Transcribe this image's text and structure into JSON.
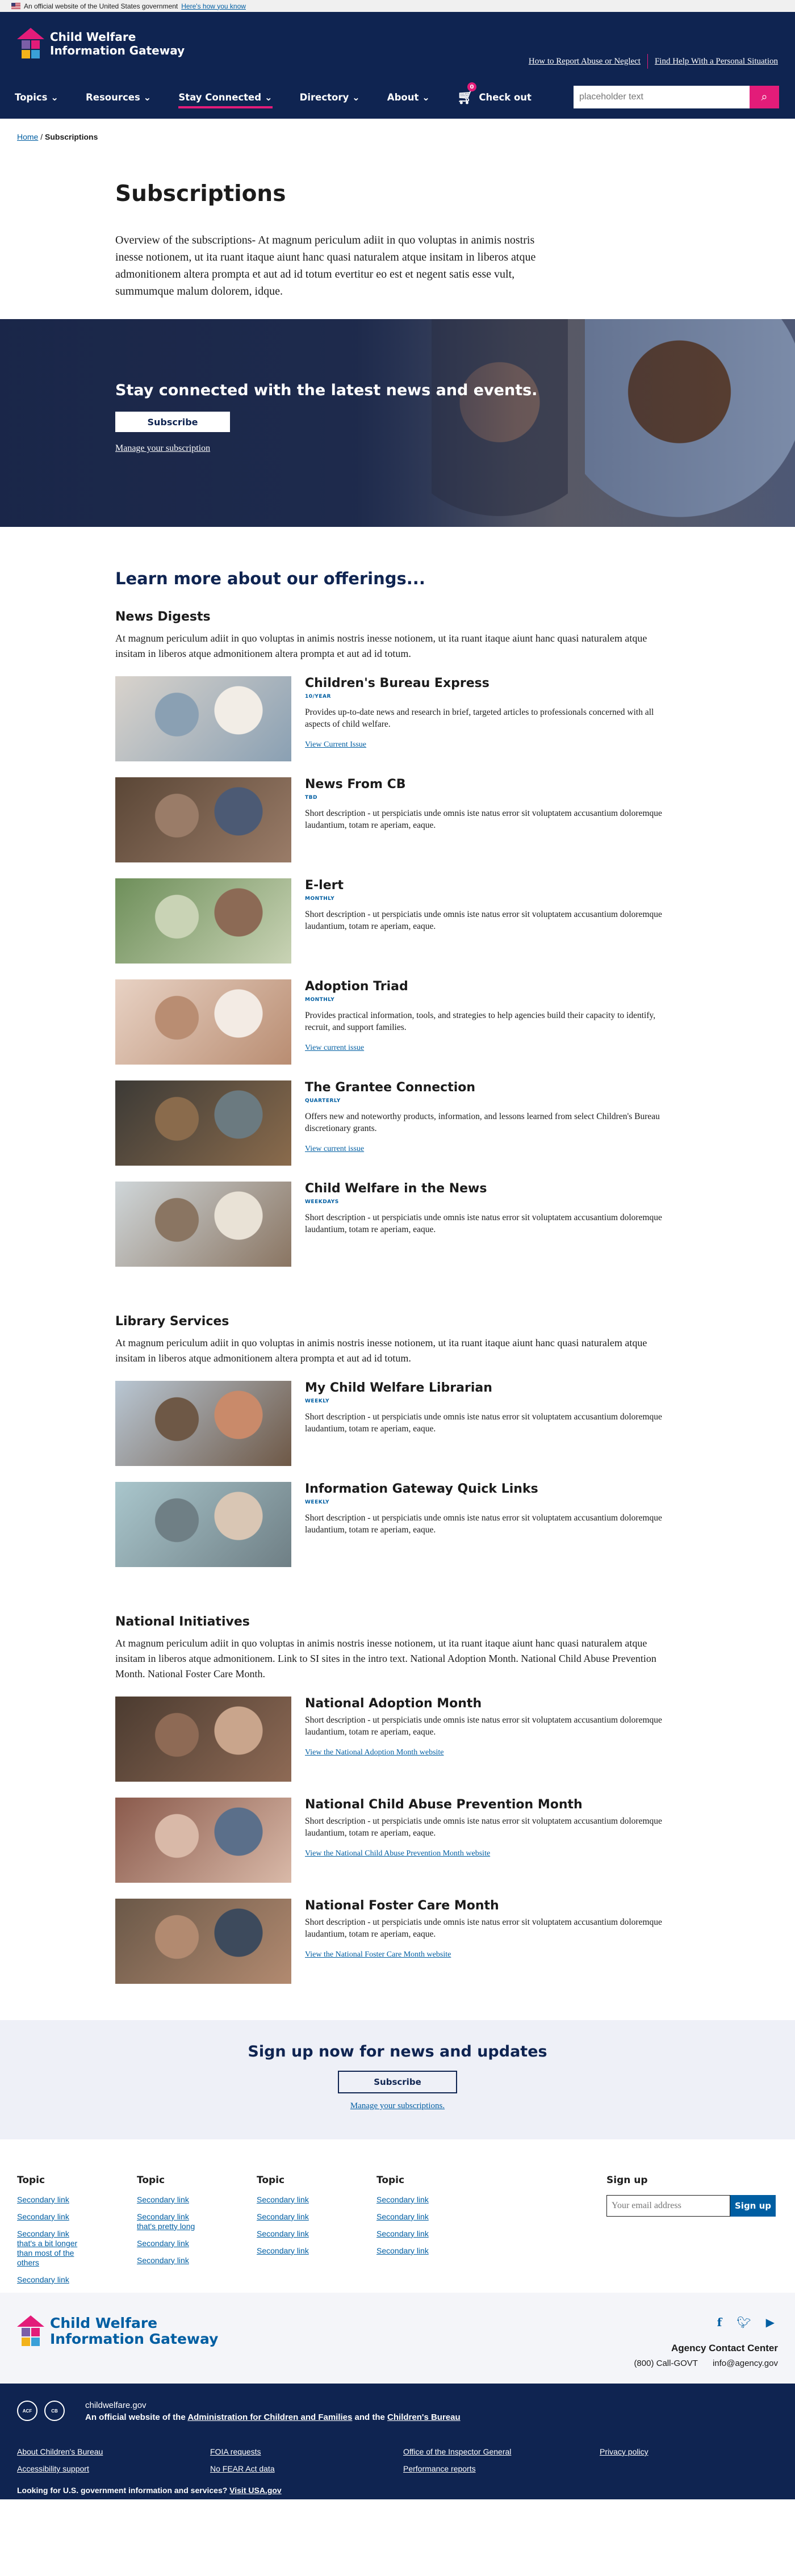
{
  "gov_banner": {
    "text": "An official website of the United States government",
    "link": "Here's how you know"
  },
  "header": {
    "logo_line1": "Child Welfare",
    "logo_line2": "Information Gateway",
    "top_links": [
      "How to Report Abuse or Neglect",
      "Find Help With a Personal Situation"
    ],
    "nav": [
      "Topics",
      "Resources",
      "Stay Connected",
      "Directory",
      "About"
    ],
    "cart_label": "Check out",
    "cart_count": "0",
    "search_placeholder": "placeholder text"
  },
  "breadcrumb": {
    "home": "Home",
    "current": "Subscriptions"
  },
  "intro": {
    "title": "Subscriptions",
    "text": "Overview of the subscriptions- At magnum periculum adiit in quo voluptas in animis nostris inesse notionem, ut ita ruant itaque aiunt hanc quasi naturalem atque insitam in liberos atque admonitionem altera prompta et aut ad id totum evertitur eo est et negent satis esse vult, summumque malum dolorem, idque."
  },
  "hero": {
    "title": "Stay connected with the latest news and events.",
    "button": "Subscribe",
    "link": "Manage your subscription"
  },
  "offerings_title": "Learn more about our offerings...",
  "groups": [
    {
      "title": "News Digests",
      "text": "At magnum periculum adiit in quo voluptas in animis nostris inesse notionem, ut ita ruant itaque aiunt hanc quasi naturalem atque insitam in liberos atque admonitionem altera prompta et aut ad id totum.",
      "cards": [
        {
          "title": "Children's Bureau Express",
          "freq": "10/YEAR",
          "desc": "Provides up-to-date news and research in brief, targeted articles to professionals concerned with all aspects of child welfare.",
          "link": "View Current Issue"
        },
        {
          "title": "News From CB",
          "freq": "TBD",
          "desc": "Short description - ut perspiciatis unde omnis iste natus error sit voluptatem accusantium doloremque laudantium, totam re aperiam, eaque.",
          "link": ""
        },
        {
          "title": "E-lert",
          "freq": "MONTHLY",
          "desc": "Short description - ut perspiciatis unde omnis iste natus error sit voluptatem accusantium doloremque laudantium, totam re aperiam, eaque.",
          "link": ""
        },
        {
          "title": "Adoption Triad",
          "freq": "MONTHLY",
          "desc": "Provides practical information, tools, and strategies to help agencies build their capacity to identify, recruit, and support families.",
          "link": "View current issue"
        },
        {
          "title": "The Grantee Connection",
          "freq": "QUARTERLY",
          "desc": "Offers new and noteworthy products, information, and lessons learned from select Children's Bureau discretionary grants.",
          "link": "View current issue"
        },
        {
          "title": "Child Welfare in the News",
          "freq": "WEEKDAYS",
          "desc": "Short description - ut perspiciatis unde omnis iste natus error sit voluptatem accusantium doloremque laudantium, totam re aperiam, eaque.",
          "link": ""
        }
      ]
    },
    {
      "title": "Library Services",
      "text": "At magnum periculum adiit in quo voluptas in animis nostris inesse notionem, ut ita ruant itaque aiunt hanc quasi naturalem atque insitam in liberos atque admonitionem altera prompta et aut ad id totum.",
      "cards": [
        {
          "title": "My Child Welfare Librarian",
          "freq": "WEEKLY",
          "desc": "Short description - ut perspiciatis unde omnis iste natus error sit voluptatem accusantium doloremque laudantium, totam re aperiam, eaque.",
          "link": ""
        },
        {
          "title": "Information Gateway Quick Links",
          "freq": "WEEKLY",
          "desc": "Short description - ut perspiciatis unde omnis iste natus error sit voluptatem accusantium doloremque laudantium, totam re aperiam, eaque.",
          "link": ""
        }
      ]
    },
    {
      "title": "National Initiatives",
      "text": "At magnum periculum adiit in quo voluptas in animis nostris inesse notionem, ut ita ruant itaque aiunt hanc quasi naturalem atque insitam in liberos atque admonitionem. Link to SI sites in the intro text. National Adoption Month. National Child Abuse Prevention Month. National Foster Care Month.",
      "cards": [
        {
          "title": "National Adoption Month",
          "freq": "",
          "desc": "Short description - ut perspiciatis unde omnis iste natus error sit voluptatem accusantium doloremque laudantium, totam re aperiam, eaque.",
          "link": "View the National Adoption Month website"
        },
        {
          "title": "National Child Abuse Prevention Month",
          "freq": "",
          "desc": "Short description - ut perspiciatis unde omnis iste natus error sit voluptatem accusantium doloremque laudantium, totam re aperiam, eaque.",
          "link": "View the National Child Abuse Prevention Month website"
        },
        {
          "title": "National Foster Care Month",
          "freq": "",
          "desc": "Short description - ut perspiciatis unde omnis iste natus error sit voluptatem accusantium doloremque laudantium, totam re aperiam, eaque.",
          "link": "View the National Foster Care Month website"
        }
      ]
    }
  ],
  "signup": {
    "title": "Sign up now for news and updates",
    "button": "Subscribe",
    "link": "Manage your subscriptions."
  },
  "footer_cols": [
    {
      "title": "Topic",
      "links": [
        "Secondary link",
        "Secondary link",
        "Secondary link that's a bit longer than most of the others",
        "Secondary link"
      ]
    },
    {
      "title": "Topic",
      "links": [
        "Secondary link",
        "Secondary link that's pretty long",
        "Secondary link",
        "Secondary link"
      ]
    },
    {
      "title": "Topic",
      "links": [
        "Secondary link",
        "Secondary link",
        "Secondary link",
        "Secondary link"
      ]
    },
    {
      "title": "Topic",
      "links": [
        "Secondary link",
        "Secondary link",
        "Secondary link",
        "Secondary link"
      ]
    }
  ],
  "footer_signup": {
    "title": "Sign up",
    "placeholder": "Your email address",
    "button": "Sign up"
  },
  "footer_contact": {
    "title": "Agency Contact Center",
    "phone": "(800) Call-GOVT",
    "email": "info@agency.gov"
  },
  "identifier": {
    "domain": "childwelfare.gov",
    "official_prefix": "An official website of the",
    "agency1": "Administration for Children and Families",
    "and": "and the",
    "agency2": "Children's Bureau",
    "links": [
      "About Children's Bureau",
      "FOIA requests",
      "Office of the Inspector General",
      "Privacy policy",
      "Accessibility support",
      "No FEAR Act data",
      "Performance reports"
    ],
    "usa_text": "Looking for U.S. government information and services?",
    "usa_link": "Visit USA.gov",
    "seal1": "ACF",
    "seal2": "CB"
  },
  "colors": {
    "navy": "#0f2451",
    "accent": "#e31c79",
    "link": "#005ea2"
  }
}
